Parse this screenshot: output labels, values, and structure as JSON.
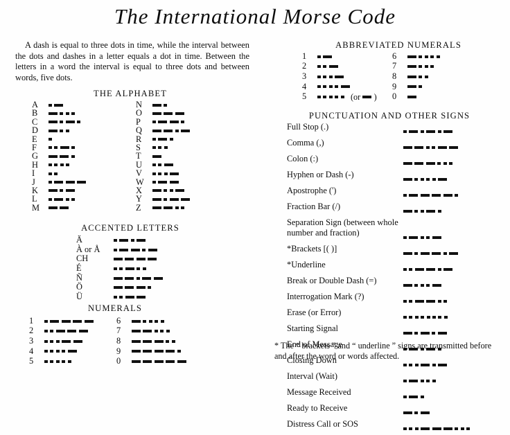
{
  "title": "The International Morse Code",
  "intro": "A dash is equal to three dots in time, while the interval between the dots and dashes in a letter equals a dot in time.   Between the letters in a word the interval is equal to three dots and between words, five dots.",
  "headings": {
    "alphabet": "THE ALPHABET",
    "accented": "ACCENTED LETTERS",
    "numerals": "NUMERALS",
    "abbreviated": "ABBREVIATED NUMERALS",
    "punctuation": "PUNCTUATION AND OTHER SIGNS"
  },
  "alphabet_left": [
    {
      "letter": "A",
      "code": ".-"
    },
    {
      "letter": "B",
      "code": "-..."
    },
    {
      "letter": "C",
      "code": "-.-."
    },
    {
      "letter": "D",
      "code": "-.."
    },
    {
      "letter": "E",
      "code": "."
    },
    {
      "letter": "F",
      "code": "..-."
    },
    {
      "letter": "G",
      "code": "--."
    },
    {
      "letter": "H",
      "code": "...."
    },
    {
      "letter": "I",
      "code": ".."
    },
    {
      "letter": "J",
      "code": ".---"
    },
    {
      "letter": "K",
      "code": "-.-"
    },
    {
      "letter": "L",
      "code": ".-.."
    },
    {
      "letter": "M",
      "code": "--"
    }
  ],
  "alphabet_right": [
    {
      "letter": "N",
      "code": "-."
    },
    {
      "letter": "O",
      "code": "---"
    },
    {
      "letter": "P",
      "code": ".--."
    },
    {
      "letter": "Q",
      "code": "--.-"
    },
    {
      "letter": "R",
      "code": ".-."
    },
    {
      "letter": "S",
      "code": "..."
    },
    {
      "letter": "T",
      "code": "-"
    },
    {
      "letter": "U",
      "code": "..-"
    },
    {
      "letter": "V",
      "code": "...-"
    },
    {
      "letter": "W",
      "code": ".--"
    },
    {
      "letter": "X",
      "code": "-..-"
    },
    {
      "letter": "Y",
      "code": "-.--"
    },
    {
      "letter": "Z",
      "code": "--.."
    }
  ],
  "accented": [
    {
      "letter": "Ä",
      "code": ".-.-"
    },
    {
      "letter": "À or Å",
      "code": ".--.-"
    },
    {
      "letter": "CH",
      "code": "----"
    },
    {
      "letter": "É",
      "code": "..-.."
    },
    {
      "letter": "Ñ",
      "code": "--.--"
    },
    {
      "letter": "Ö",
      "code": "---."
    },
    {
      "letter": "Ü",
      "code": "..--"
    }
  ],
  "numerals_left": [
    {
      "letter": "1",
      "code": ".----"
    },
    {
      "letter": "2",
      "code": "..---"
    },
    {
      "letter": "3",
      "code": "...--"
    },
    {
      "letter": "4",
      "code": "....-"
    },
    {
      "letter": "5",
      "code": "....."
    }
  ],
  "numerals_right": [
    {
      "letter": "6",
      "code": "-...."
    },
    {
      "letter": "7",
      "code": "--..."
    },
    {
      "letter": "8",
      "code": "---.."
    },
    {
      "letter": "9",
      "code": "----."
    },
    {
      "letter": "0",
      "code": "-----"
    }
  ],
  "abbreviated_left": [
    {
      "letter": "1",
      "code": ".-",
      "note": ""
    },
    {
      "letter": "2",
      "code": "..-",
      "note": ""
    },
    {
      "letter": "3",
      "code": "...-",
      "note": ""
    },
    {
      "letter": "4",
      "code": "....-",
      "note": ""
    },
    {
      "letter": "5",
      "code": ".....",
      "note": "(or",
      "note_code": "-",
      "note_end": ")"
    }
  ],
  "abbreviated_right": [
    {
      "letter": "6",
      "code": "-...."
    },
    {
      "letter": "7",
      "code": "-..."
    },
    {
      "letter": "8",
      "code": "-.."
    },
    {
      "letter": "9",
      "code": "-."
    },
    {
      "letter": "0",
      "code": "-"
    }
  ],
  "punctuation": [
    {
      "label": "Full Stop (.)",
      "code": ".-.-.-"
    },
    {
      "label": "Comma (,)",
      "code": "--..--"
    },
    {
      "label": "Colon (:)",
      "code": "---..."
    },
    {
      "label": "Hyphen or Dash (-)",
      "code": "-....-"
    },
    {
      "label": "Apostrophe (')",
      "code": ".----."
    },
    {
      "label": "Fraction Bar (/)",
      "code": "-..-."
    },
    {
      "label": "Separation Sign  (between whole number and fraction)",
      "code": ".-..-"
    },
    {
      "label": "*Brackets [( )]",
      "code": "-.--.-"
    },
    {
      "label": "*Underline",
      "code": "..--.-"
    },
    {
      "label": "Break or Double Dash (=)",
      "code": "-...-"
    },
    {
      "label": "Interrogation Mark (?)",
      "code": "..--.."
    },
    {
      "label": "Erase (or Error)",
      "code": "........"
    },
    {
      "label": "Starting Signal",
      "code": "-.-.-"
    },
    {
      "label": "End of Message",
      "code": ".-.-."
    },
    {
      "label": "Closing Down",
      "code": "...-.-"
    },
    {
      "label": "Interval (Wait)",
      "code": ".-..."
    },
    {
      "label": "Message Received",
      "code": ".-."
    },
    {
      "label": "Ready to Receive",
      "code": "-.-"
    },
    {
      "label": "Distress Call or SOS",
      "code": "...---..."
    }
  ],
  "footnote": "* The “ brackets ” and “ underline ” signs are transmitted before and after the word or words affected."
}
